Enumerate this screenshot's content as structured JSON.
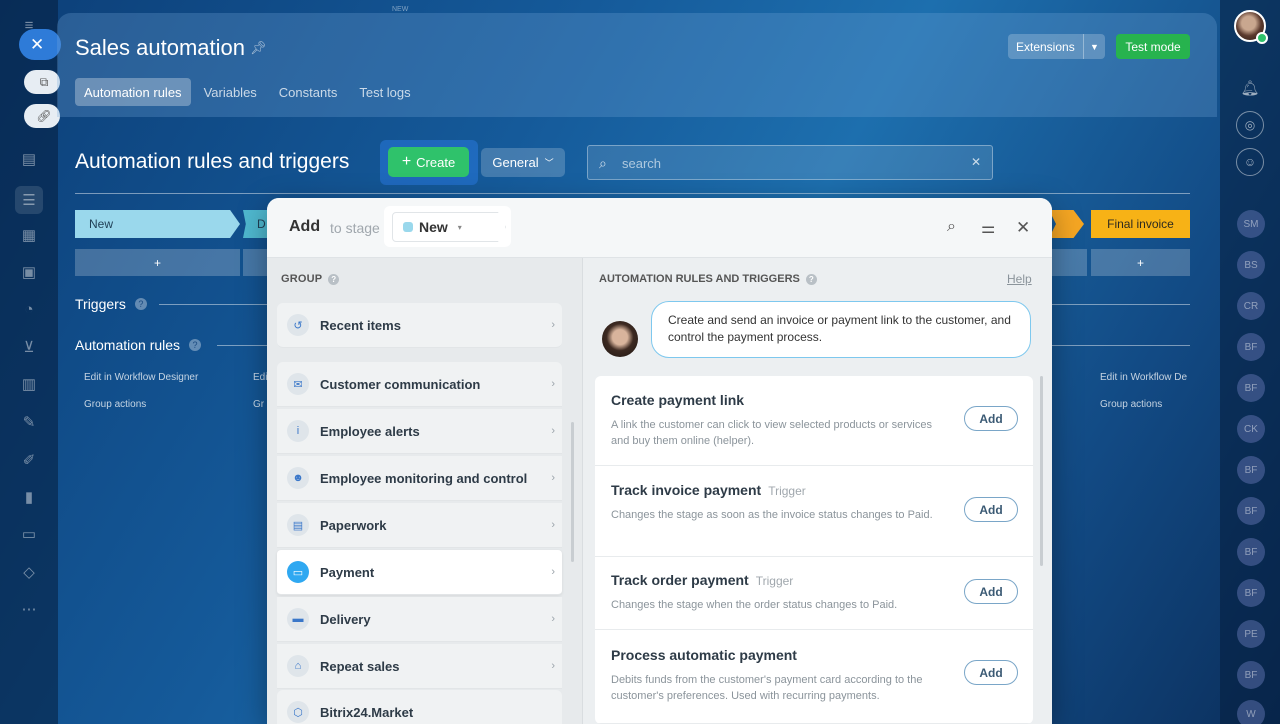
{
  "app": {
    "title": "Sales automation",
    "extensions_label": "Extensions",
    "test_mode_label": "Test mode",
    "tabs": [
      "Automation rules",
      "Variables",
      "Constants",
      "Test logs"
    ]
  },
  "toolbar": {
    "section_title": "Automation rules and triggers",
    "create_label": "Create",
    "general_label": "General",
    "search_placeholder": "search"
  },
  "stages": {
    "first": "New",
    "second_partial": "D",
    "last": "Final invoice",
    "plus": "+"
  },
  "rows": {
    "triggers": "Triggers",
    "automation_rules": "Automation rules",
    "edit_designer": "Edit in Workflow Designer",
    "edit_designer_partial": "Edi",
    "edit_designer_right": "Edit in Workflow De",
    "group_actions": "Group actions",
    "group_actions_partial": "Gr"
  },
  "right_rail": {
    "avatars": [
      "SM",
      "BS",
      "CR",
      "BF",
      "BF",
      "CK",
      "BF",
      "BF",
      "BF",
      "BF",
      "PE",
      "BF",
      "W"
    ]
  },
  "left_rail": {
    "top_label": "NEW"
  },
  "modal": {
    "add_label": "Add",
    "to_stage_label": "to stage",
    "stage_name": "New",
    "group_header": "GROUP",
    "rules_header": "AUTOMATION RULES AND TRIGGERS",
    "help_label": "Help",
    "hint_text": "Create and send an invoice or payment link to the customer, and control the payment process.",
    "groups": [
      {
        "label": "Recent items",
        "icon": "history-icon"
      },
      {
        "label": "Customer communication",
        "icon": "chat-icon"
      },
      {
        "label": "Employee alerts",
        "icon": "info-icon"
      },
      {
        "label": "Employee monitoring and control",
        "icon": "users-icon"
      },
      {
        "label": "Paperwork",
        "icon": "document-icon"
      },
      {
        "label": "Payment",
        "icon": "wallet-icon"
      },
      {
        "label": "Delivery",
        "icon": "truck-icon"
      },
      {
        "label": "Repeat sales",
        "icon": "shop-icon"
      },
      {
        "label": "Bitrix24.Market",
        "icon": "market-icon"
      }
    ],
    "selected_group": "Payment",
    "add_button_label": "Add",
    "trigger_tag": "Trigger",
    "cards": [
      {
        "title": "Create payment link",
        "tag": "",
        "desc": "A link the customer can click to view selected products or services and buy them online (helper)."
      },
      {
        "title": "Track invoice payment",
        "tag": "Trigger",
        "desc": "Changes the stage as soon as the invoice status changes to Paid."
      },
      {
        "title": "Track order payment",
        "tag": "Trigger",
        "desc": "Changes the stage when the order status changes to Paid."
      },
      {
        "title": "Process automatic payment",
        "tag": "",
        "desc": "Debits funds from the customer's payment card according to the customer's preferences. Used with recurring payments."
      }
    ]
  },
  "colors": {
    "accent_green": "#2fc26b",
    "stage_new": "#9ad8ec",
    "stage_final": "#f7b216",
    "selected_group_icon": "#2fa8f1"
  }
}
